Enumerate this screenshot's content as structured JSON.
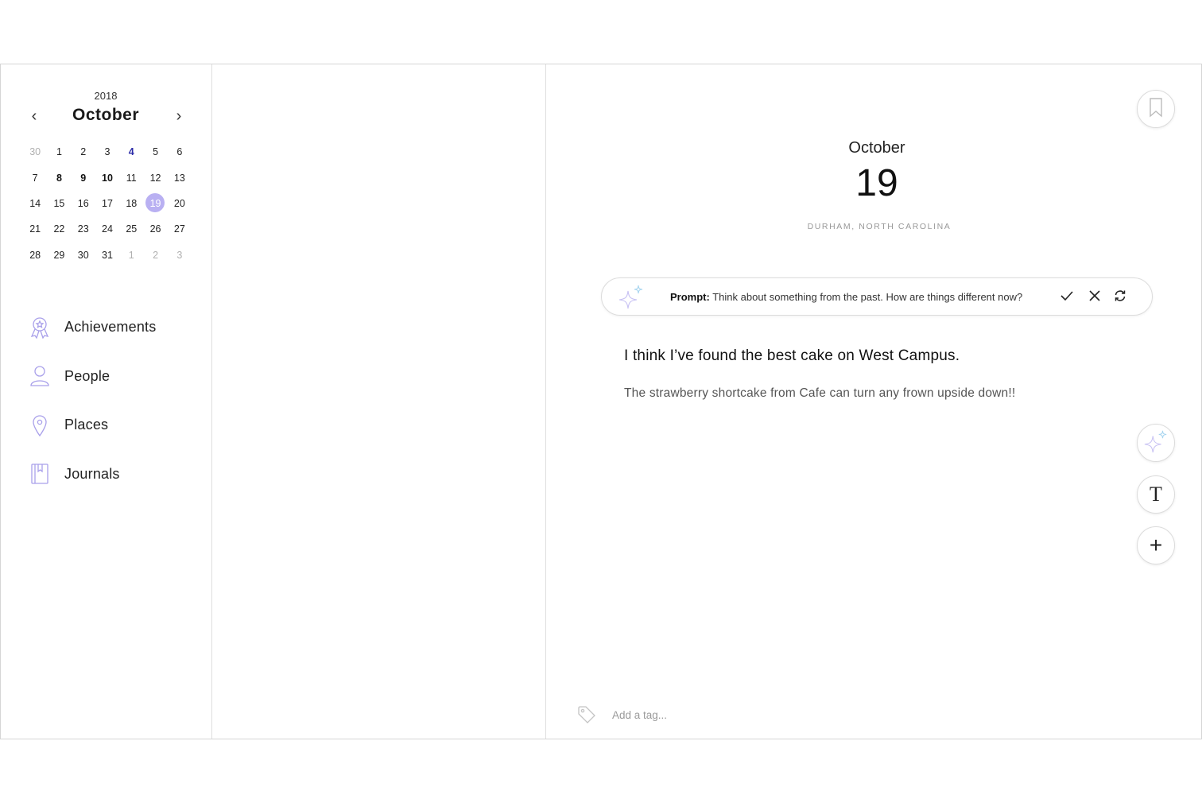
{
  "calendar": {
    "year": "2018",
    "month": "October",
    "prev_icon": "chevron-left-icon",
    "next_icon": "chevron-right-icon",
    "weeks": [
      [
        {
          "d": "30",
          "s": "muted"
        },
        {
          "d": "1",
          "s": ""
        },
        {
          "d": "2",
          "s": ""
        },
        {
          "d": "3",
          "s": ""
        },
        {
          "d": "4",
          "s": "today"
        },
        {
          "d": "5",
          "s": ""
        },
        {
          "d": "6",
          "s": ""
        }
      ],
      [
        {
          "d": "7",
          "s": ""
        },
        {
          "d": "8",
          "s": "bold"
        },
        {
          "d": "9",
          "s": "bold"
        },
        {
          "d": "10",
          "s": "bold"
        },
        {
          "d": "11",
          "s": ""
        },
        {
          "d": "12",
          "s": ""
        },
        {
          "d": "13",
          "s": ""
        }
      ],
      [
        {
          "d": "14",
          "s": ""
        },
        {
          "d": "15",
          "s": ""
        },
        {
          "d": "16",
          "s": ""
        },
        {
          "d": "17",
          "s": ""
        },
        {
          "d": "18",
          "s": ""
        },
        {
          "d": "19",
          "s": "selected"
        },
        {
          "d": "20",
          "s": ""
        }
      ],
      [
        {
          "d": "21",
          "s": ""
        },
        {
          "d": "22",
          "s": ""
        },
        {
          "d": "23",
          "s": ""
        },
        {
          "d": "24",
          "s": ""
        },
        {
          "d": "25",
          "s": ""
        },
        {
          "d": "26",
          "s": ""
        },
        {
          "d": "27",
          "s": ""
        }
      ],
      [
        {
          "d": "28",
          "s": ""
        },
        {
          "d": "29",
          "s": ""
        },
        {
          "d": "30",
          "s": ""
        },
        {
          "d": "31",
          "s": ""
        },
        {
          "d": "1",
          "s": "muted"
        },
        {
          "d": "2",
          "s": "muted"
        },
        {
          "d": "3",
          "s": "muted"
        }
      ]
    ]
  },
  "nav": {
    "items": [
      {
        "label": "Achievements",
        "icon": "award-icon"
      },
      {
        "label": "People",
        "icon": "person-icon"
      },
      {
        "label": "Places",
        "icon": "location-pin-icon"
      },
      {
        "label": "Journals",
        "icon": "book-icon"
      }
    ]
  },
  "entry": {
    "month": "October",
    "day": "19",
    "location": "DURHAM, NORTH CAROLINA",
    "prompt_label": "Prompt:",
    "prompt_text": "Think about something from the past. How are things different now?",
    "title": "I think I’ve found the best cake on West Campus.",
    "body": "The strawberry shortcake from Cafe can turn any frown upside down!!",
    "tag_placeholder": "Add a tag..."
  },
  "tools": {
    "text_label": "T",
    "add_label": "+"
  },
  "colors": {
    "accent": "#b9b0f2",
    "today": "#2b2ba8",
    "icon_stroke": "#a9a0ea"
  }
}
